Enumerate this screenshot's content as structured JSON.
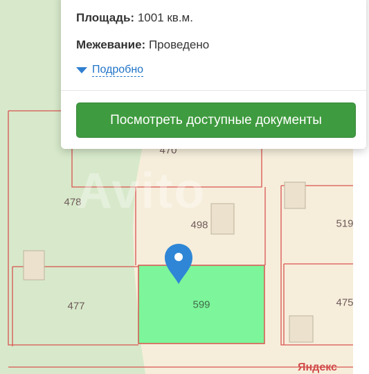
{
  "info_card": {
    "area_label": "Площадь:",
    "area_value": "1001 кв.м.",
    "survey_label": "Межевание:",
    "survey_value": "Проведено",
    "details_link": "Подробно",
    "docs_button": "Посмотреть доступные документы"
  },
  "map": {
    "selected_parcel": "599",
    "parcels": [
      "470",
      "478",
      "498",
      "519",
      "477",
      "599",
      "475"
    ],
    "watermark": "Avito",
    "provider_text": "Яндекс",
    "colors": {
      "background": "#f6eedb",
      "forest": "#d7e9ca",
      "boundary": "#d9534f",
      "selected": "#7df59a",
      "button": "#3f9b3f",
      "link": "#1e73c8"
    },
    "marker_icon": "map-pin-icon"
  }
}
